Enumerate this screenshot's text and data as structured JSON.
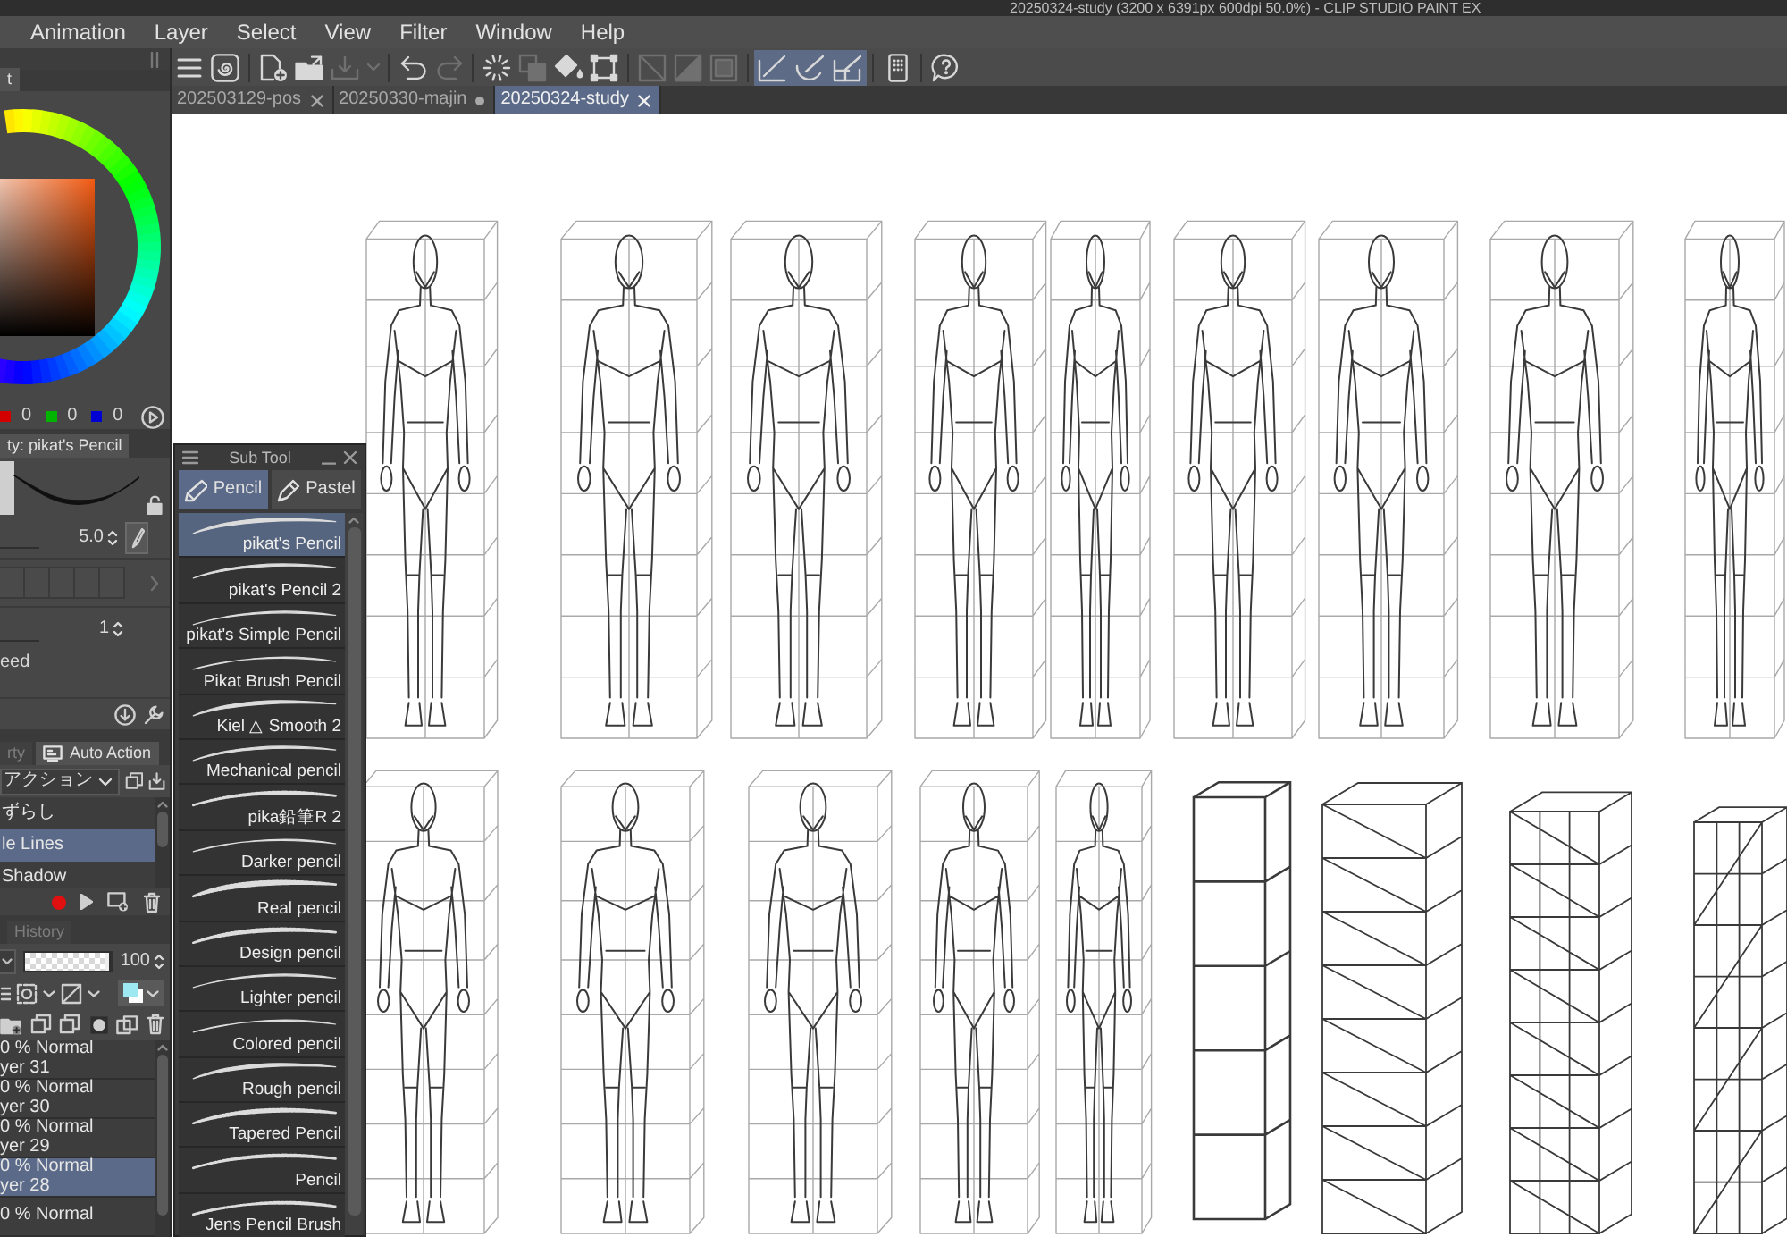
{
  "window": {
    "title": "20250324-study (3200 x 6391px 600dpi 50.0%) - CLIP STUDIO PAINT EX"
  },
  "menu": [
    "Animation",
    "Layer",
    "Select",
    "View",
    "Filter",
    "Window",
    "Help"
  ],
  "toolbar": [
    [
      {
        "kind": "menu",
        "disabled": false,
        "on": false
      },
      {
        "kind": "logo",
        "disabled": false,
        "on": false
      }
    ],
    [
      {
        "kind": "new",
        "disabled": false,
        "on": false
      },
      {
        "kind": "open",
        "disabled": false,
        "on": false
      },
      {
        "kind": "save",
        "disabled": true,
        "on": false
      },
      {
        "kind": "dropdown",
        "disabled": true,
        "on": false
      }
    ],
    [
      {
        "kind": "undo",
        "disabled": false,
        "on": false
      },
      {
        "kind": "redo",
        "disabled": true,
        "on": false
      }
    ],
    [
      {
        "kind": "loading",
        "disabled": false,
        "on": false
      },
      {
        "kind": "transform",
        "disabled": true,
        "on": false
      },
      {
        "kind": "fill",
        "disabled": false,
        "on": false
      },
      {
        "kind": "select",
        "disabled": false,
        "on": false
      }
    ],
    [
      {
        "kind": "clear",
        "disabled": true,
        "on": false
      },
      {
        "kind": "fill-select",
        "disabled": true,
        "on": false
      },
      {
        "kind": "frame",
        "disabled": true,
        "on": false
      }
    ],
    [
      {
        "kind": "snap-ruler",
        "disabled": false,
        "on": true
      },
      {
        "kind": "snap-special",
        "disabled": false,
        "on": true
      },
      {
        "kind": "snap-grid",
        "disabled": false,
        "on": true
      }
    ],
    [
      {
        "kind": "tablet",
        "disabled": false,
        "on": false
      }
    ],
    [
      {
        "kind": "help",
        "disabled": false,
        "on": false
      }
    ]
  ],
  "document_tabs": [
    {
      "label": "202503129-pos",
      "modified": false,
      "selected": false
    },
    {
      "label": "20250330-majin",
      "modified": true,
      "selected": false
    },
    {
      "label": "20250324-study",
      "modified": false,
      "selected": true
    }
  ],
  "color_panel": {
    "tab": "t",
    "channels": [
      {
        "color": "#d40000",
        "value": "0"
      },
      {
        "color": "#00b400",
        "value": "0"
      },
      {
        "color": "#0000d2",
        "value": "0"
      }
    ]
  },
  "tool_property": {
    "tab": "ty: pikat's Pencil",
    "brush_size": "5.0",
    "setting_value": "1",
    "setting_label": "eed"
  },
  "auto_action": {
    "tabs": [
      {
        "label": "rty",
        "selected": false
      },
      {
        "label": "Auto Action",
        "selected": true
      }
    ],
    "action_set": "アクション",
    "actions": [
      {
        "label": "ずらし",
        "selected": false
      },
      {
        "label": "le Lines",
        "selected": true
      },
      {
        "label": "Shadow",
        "selected": false
      }
    ]
  },
  "layer_panel": {
    "tab": "History",
    "opacity": {
      "value": "100",
      "level": 1
    },
    "layers": [
      {
        "mode": "0 % Normal",
        "name": "yer 31",
        "selected": false
      },
      {
        "mode": "0 % Normal",
        "name": "yer 30",
        "selected": false
      },
      {
        "mode": "0 % Normal",
        "name": "yer 29",
        "selected": false
      },
      {
        "mode": "0 % Normal",
        "name": "yer 28",
        "selected": true
      },
      {
        "mode": "0 % Normal",
        "selected": false
      }
    ]
  },
  "sub_tool": {
    "title": "Sub Tool",
    "tabs": [
      {
        "label": "Pencil",
        "selected": true
      },
      {
        "label": "Pastel",
        "selected": false
      }
    ],
    "brushes": [
      {
        "name": "pikat's Pencil",
        "selected": true
      },
      {
        "name": "pikat's Pencil 2",
        "selected": false
      },
      {
        "name": "pikat's Simple Pencil",
        "selected": false
      },
      {
        "name": "Pikat Brush Pencil",
        "selected": false
      },
      {
        "name": "Kiel △ Smooth 2",
        "selected": false
      },
      {
        "name": "Mechanical pencil",
        "selected": false
      },
      {
        "name": "pika鉛筆R 2",
        "selected": false
      },
      {
        "name": "Darker pencil",
        "selected": false
      },
      {
        "name": "Real pencil",
        "selected": false
      },
      {
        "name": "Design pencil",
        "selected": false
      },
      {
        "name": "Lighter pencil",
        "selected": false
      },
      {
        "name": "Colored pencil",
        "selected": false
      },
      {
        "name": "Rough pencil",
        "selected": false
      },
      {
        "name": "Tapered Pencil",
        "selected": false
      },
      {
        "name": "Pencil",
        "selected": false
      },
      {
        "name": "Jens Pencil Brush",
        "selected": false
      }
    ]
  }
}
